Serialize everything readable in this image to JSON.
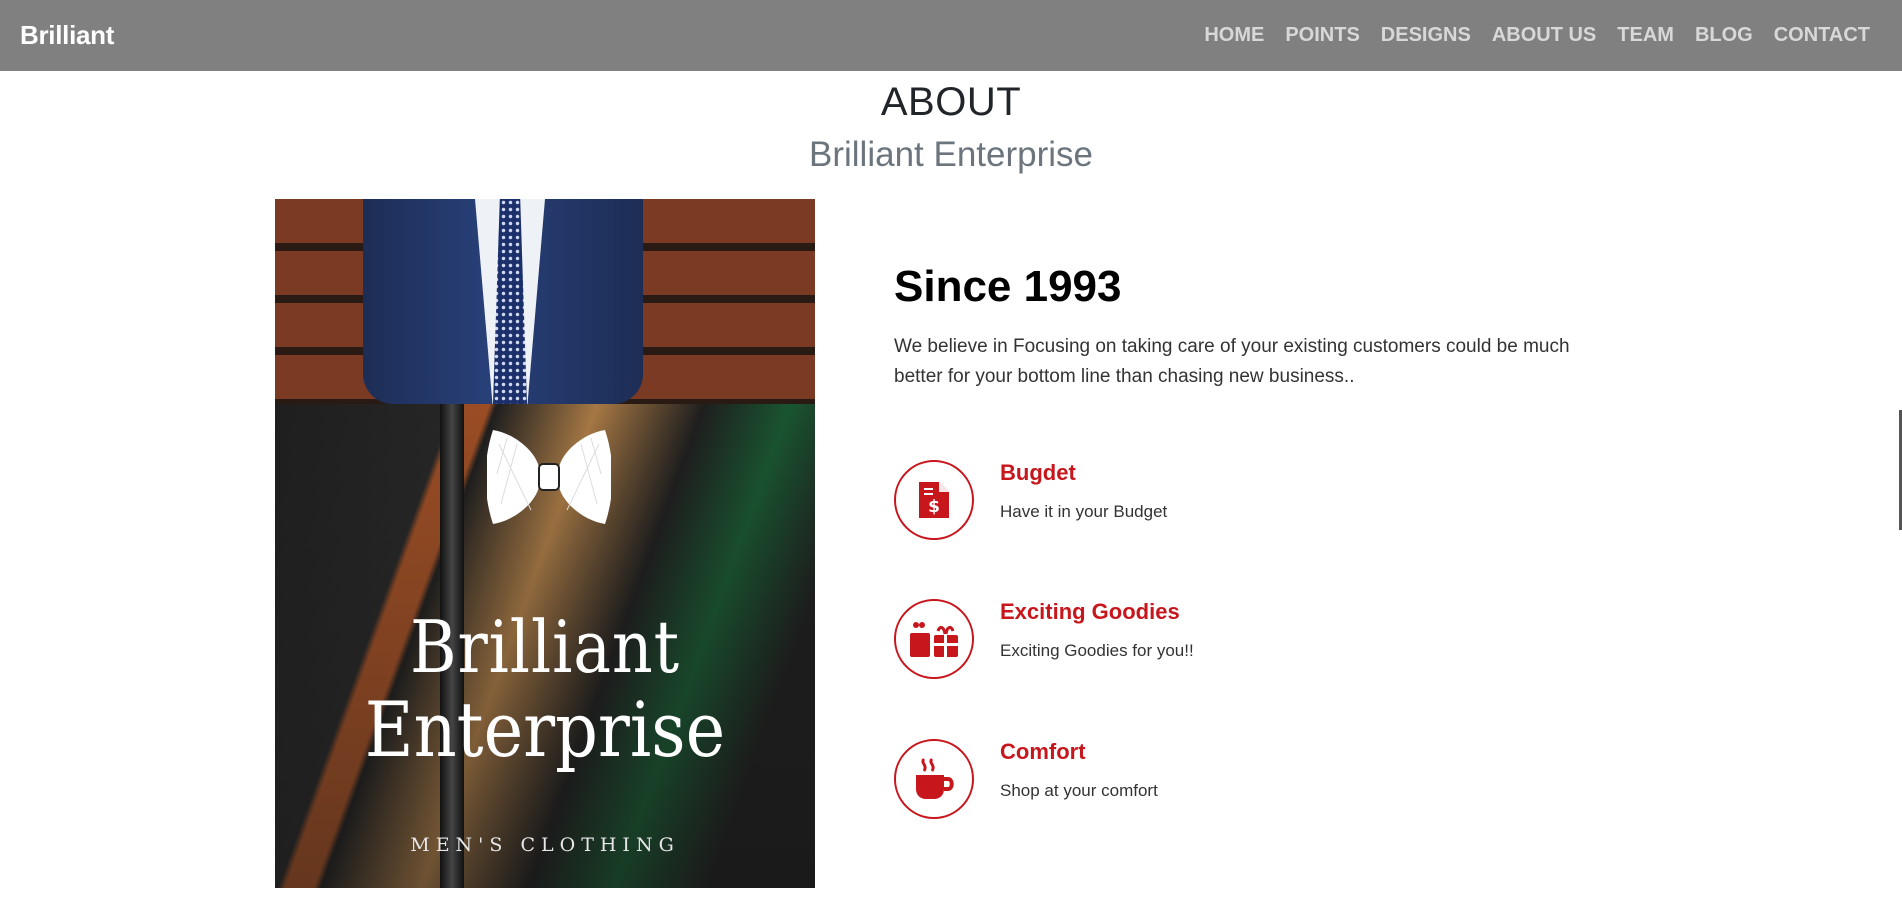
{
  "navbar": {
    "brand": "Brilliant",
    "links": [
      "HOME",
      "POINTS",
      "DESIGNS",
      "ABOUT US",
      "TEAM",
      "BLOG",
      "CONTACT"
    ]
  },
  "about": {
    "title": "ABOUT",
    "subtitle": "Brilliant Enterprise"
  },
  "image": {
    "logo_line1": "Brilliant",
    "logo_line2": "Enterprise",
    "tagline": "MEN'S CLOTHING"
  },
  "since": {
    "heading": "Since 1993",
    "text": "We believe in Focusing on taking care of your existing customers could be much better for your bottom line than chasing new business.."
  },
  "features": [
    {
      "icon": "invoice-dollar-icon",
      "title": "Bugdet",
      "text": "Have it in your Budget"
    },
    {
      "icon": "gifts-icon",
      "title": "Exciting Goodies",
      "text": "Exciting Goodies for you!!"
    },
    {
      "icon": "coffee-cup-icon",
      "title": "Comfort",
      "text": "Shop at your comfort"
    }
  ],
  "colors": {
    "navbar_bg": "#808080",
    "accent": "#c8161d",
    "subtitle": "#6c757d"
  }
}
